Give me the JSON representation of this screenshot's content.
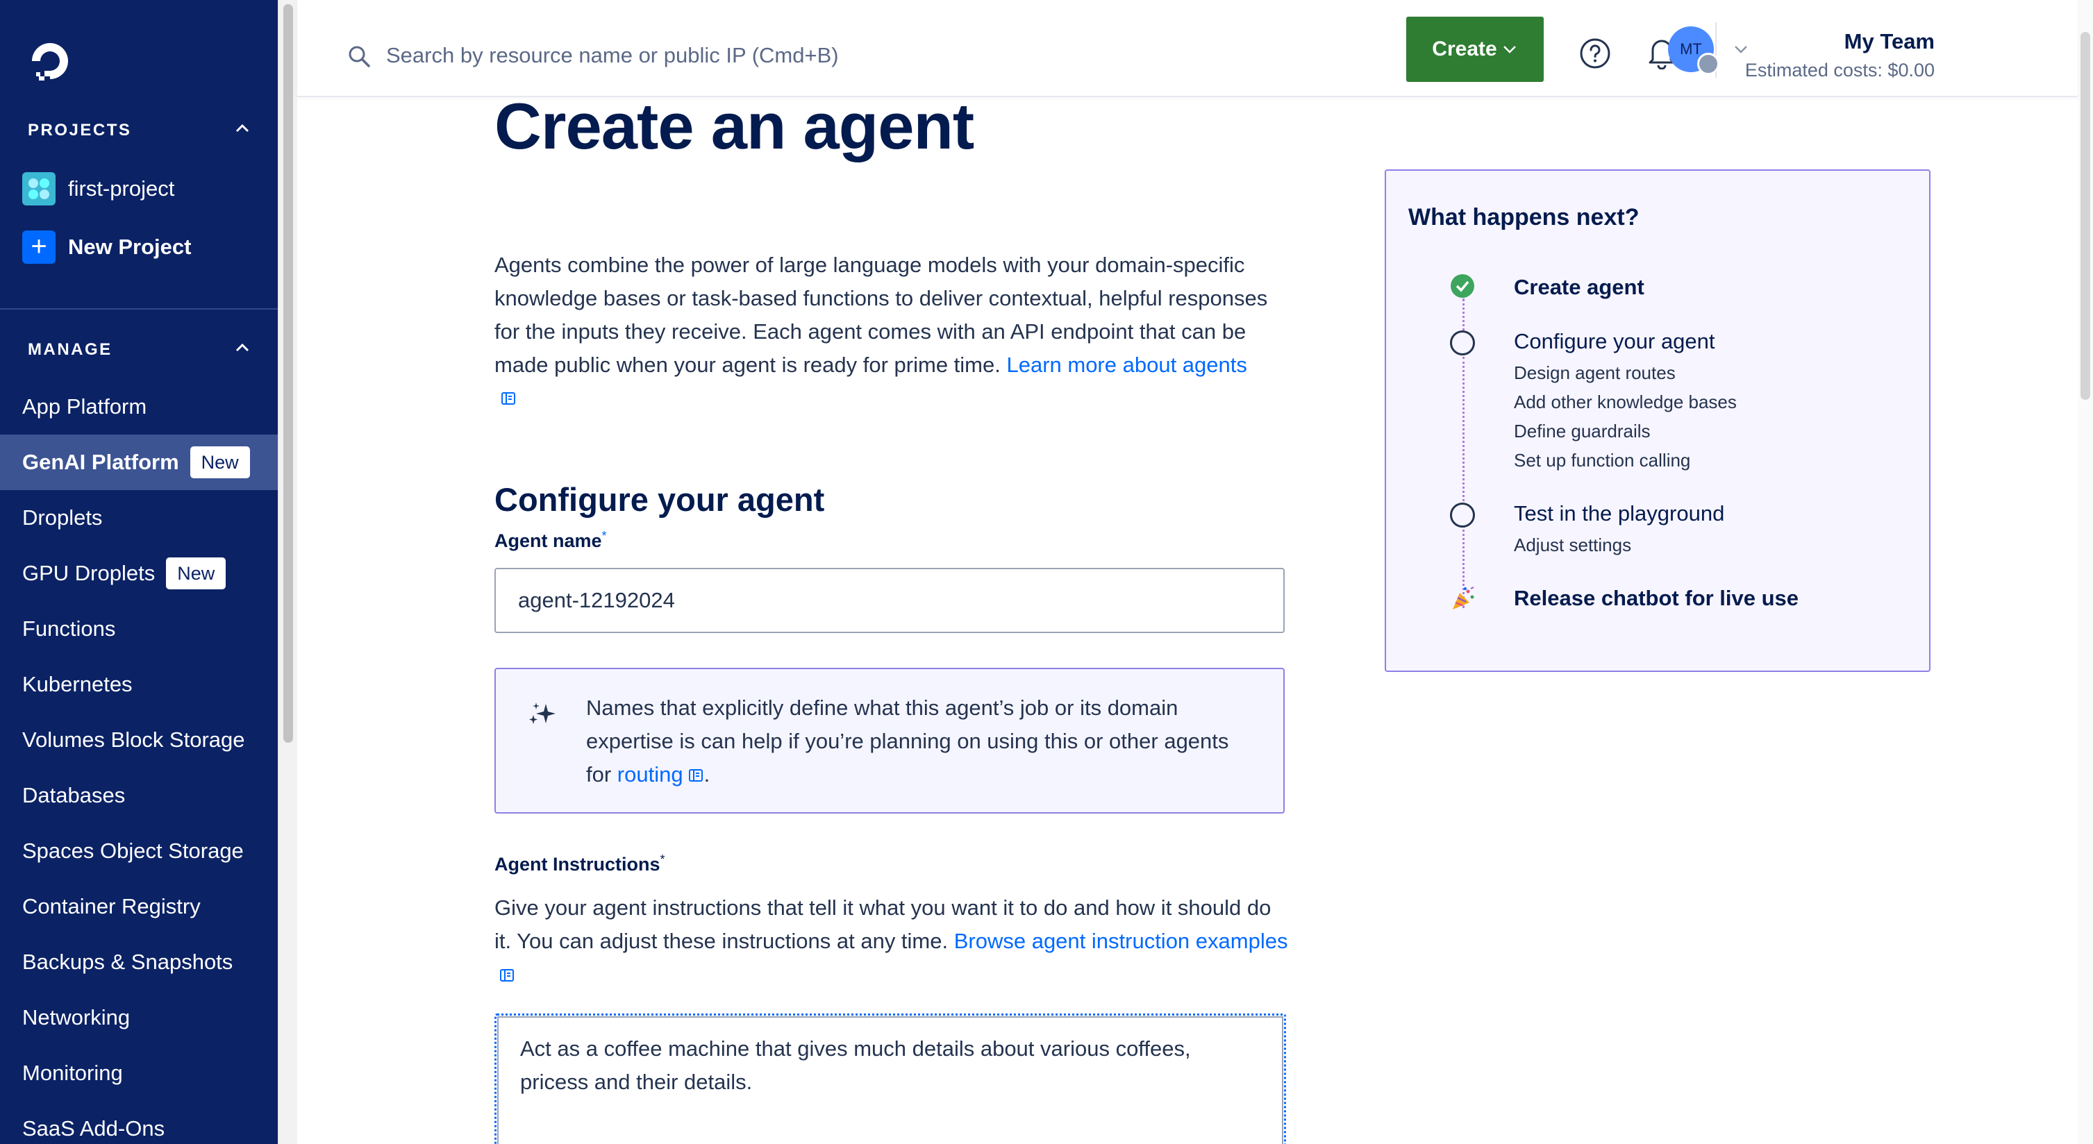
{
  "sidebar": {
    "projects_heading": "PROJECTS",
    "projects": [
      {
        "label": "first-project"
      },
      {
        "label": "New Project"
      }
    ],
    "manage_heading": "MANAGE",
    "nav": [
      {
        "label": "App Platform"
      },
      {
        "label": "GenAI Platform",
        "badge": "New",
        "active": true
      },
      {
        "label": "Droplets"
      },
      {
        "label": "GPU Droplets",
        "badge": "New"
      },
      {
        "label": "Functions"
      },
      {
        "label": "Kubernetes"
      },
      {
        "label": "Volumes Block Storage"
      },
      {
        "label": "Databases"
      },
      {
        "label": "Spaces Object Storage"
      },
      {
        "label": "Container Registry"
      },
      {
        "label": "Backups & Snapshots"
      },
      {
        "label": "Networking"
      },
      {
        "label": "Monitoring"
      },
      {
        "label": "SaaS Add-Ons"
      }
    ]
  },
  "topbar": {
    "search_placeholder": "Search by resource name or public IP (Cmd+B)",
    "create_label": "Create",
    "team_name": "My Team",
    "estimated_costs": "Estimated costs: $0.00",
    "avatar_initials": "MT"
  },
  "main": {
    "title": "Create an agent",
    "intro_text": "Agents combine the power of large language models with your domain-specific knowledge bases or task-based functions to deliver contextual, helpful responses for the inputs they receive. Each agent comes with an API endpoint that can be made public when your agent is ready for prime time. ",
    "intro_link": "Learn more about agents",
    "section_title": "Configure your agent",
    "agent_name_label": "Agent name",
    "required_mark": "*",
    "agent_name_value": "agent-12192024",
    "tip_text": "Names that explicitly define what this agent’s job or its domain expertise is can help if you’re planning on using this or other agents for ",
    "tip_link": "routing",
    "tip_end": ".",
    "instructions_label": "Agent Instructions",
    "instructions_desc": "Give your agent instructions that tell it what you want it to do and how it should do it. You can adjust these instructions at any time. ",
    "instructions_link": "Browse agent instruction examples",
    "instructions_value": "Act as a coffee machine that gives much details about various coffees, pricess and their details."
  },
  "next_panel": {
    "title": "What happens next?",
    "steps": [
      {
        "label": "Create agent",
        "state": "done",
        "subs": []
      },
      {
        "label": "Configure your agent",
        "state": "pending",
        "subs": [
          "Design agent routes",
          "Add other knowledge bases",
          "Define guardrails",
          "Set up function calling"
        ]
      },
      {
        "label": "Test in the playground",
        "state": "pending",
        "subs": [
          "Adjust settings"
        ]
      },
      {
        "label": "Release chatbot for live use",
        "state": "final",
        "subs": []
      }
    ]
  },
  "colors": {
    "sidebar_bg": "#0b2265",
    "sidebar_active": "#3d5493",
    "create_button": "#2e7d32",
    "link": "#0069ff",
    "tip_border": "#8e80e8",
    "step_done": "#3da55d"
  }
}
